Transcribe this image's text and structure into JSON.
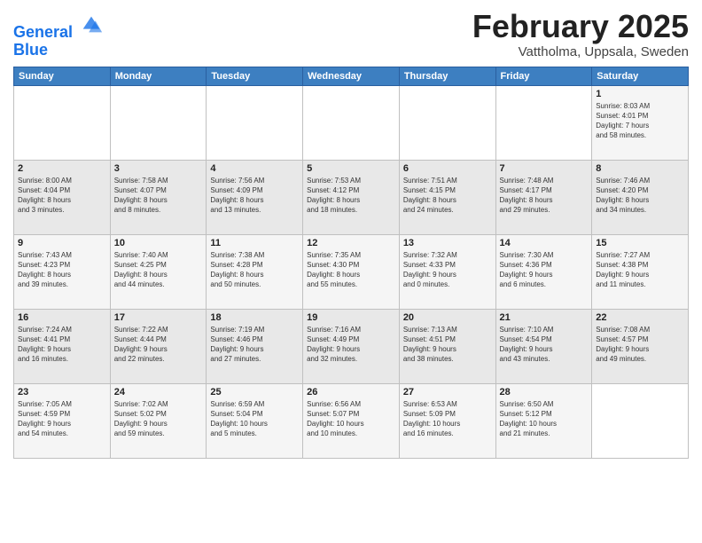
{
  "header": {
    "logo_line1": "General",
    "logo_line2": "Blue",
    "month_title": "February 2025",
    "subtitle": "Vattholma, Uppsala, Sweden"
  },
  "weekdays": [
    "Sunday",
    "Monday",
    "Tuesday",
    "Wednesday",
    "Thursday",
    "Friday",
    "Saturday"
  ],
  "rows": [
    [
      {
        "day": "",
        "info": ""
      },
      {
        "day": "",
        "info": ""
      },
      {
        "day": "",
        "info": ""
      },
      {
        "day": "",
        "info": ""
      },
      {
        "day": "",
        "info": ""
      },
      {
        "day": "",
        "info": ""
      },
      {
        "day": "1",
        "info": "Sunrise: 8:03 AM\nSunset: 4:01 PM\nDaylight: 7 hours\nand 58 minutes."
      }
    ],
    [
      {
        "day": "2",
        "info": "Sunrise: 8:00 AM\nSunset: 4:04 PM\nDaylight: 8 hours\nand 3 minutes."
      },
      {
        "day": "3",
        "info": "Sunrise: 7:58 AM\nSunset: 4:07 PM\nDaylight: 8 hours\nand 8 minutes."
      },
      {
        "day": "4",
        "info": "Sunrise: 7:56 AM\nSunset: 4:09 PM\nDaylight: 8 hours\nand 13 minutes."
      },
      {
        "day": "5",
        "info": "Sunrise: 7:53 AM\nSunset: 4:12 PM\nDaylight: 8 hours\nand 18 minutes."
      },
      {
        "day": "6",
        "info": "Sunrise: 7:51 AM\nSunset: 4:15 PM\nDaylight: 8 hours\nand 24 minutes."
      },
      {
        "day": "7",
        "info": "Sunrise: 7:48 AM\nSunset: 4:17 PM\nDaylight: 8 hours\nand 29 minutes."
      },
      {
        "day": "8",
        "info": "Sunrise: 7:46 AM\nSunset: 4:20 PM\nDaylight: 8 hours\nand 34 minutes."
      }
    ],
    [
      {
        "day": "9",
        "info": "Sunrise: 7:43 AM\nSunset: 4:23 PM\nDaylight: 8 hours\nand 39 minutes."
      },
      {
        "day": "10",
        "info": "Sunrise: 7:40 AM\nSunset: 4:25 PM\nDaylight: 8 hours\nand 44 minutes."
      },
      {
        "day": "11",
        "info": "Sunrise: 7:38 AM\nSunset: 4:28 PM\nDaylight: 8 hours\nand 50 minutes."
      },
      {
        "day": "12",
        "info": "Sunrise: 7:35 AM\nSunset: 4:30 PM\nDaylight: 8 hours\nand 55 minutes."
      },
      {
        "day": "13",
        "info": "Sunrise: 7:32 AM\nSunset: 4:33 PM\nDaylight: 9 hours\nand 0 minutes."
      },
      {
        "day": "14",
        "info": "Sunrise: 7:30 AM\nSunset: 4:36 PM\nDaylight: 9 hours\nand 6 minutes."
      },
      {
        "day": "15",
        "info": "Sunrise: 7:27 AM\nSunset: 4:38 PM\nDaylight: 9 hours\nand 11 minutes."
      }
    ],
    [
      {
        "day": "16",
        "info": "Sunrise: 7:24 AM\nSunset: 4:41 PM\nDaylight: 9 hours\nand 16 minutes."
      },
      {
        "day": "17",
        "info": "Sunrise: 7:22 AM\nSunset: 4:44 PM\nDaylight: 9 hours\nand 22 minutes."
      },
      {
        "day": "18",
        "info": "Sunrise: 7:19 AM\nSunset: 4:46 PM\nDaylight: 9 hours\nand 27 minutes."
      },
      {
        "day": "19",
        "info": "Sunrise: 7:16 AM\nSunset: 4:49 PM\nDaylight: 9 hours\nand 32 minutes."
      },
      {
        "day": "20",
        "info": "Sunrise: 7:13 AM\nSunset: 4:51 PM\nDaylight: 9 hours\nand 38 minutes."
      },
      {
        "day": "21",
        "info": "Sunrise: 7:10 AM\nSunset: 4:54 PM\nDaylight: 9 hours\nand 43 minutes."
      },
      {
        "day": "22",
        "info": "Sunrise: 7:08 AM\nSunset: 4:57 PM\nDaylight: 9 hours\nand 49 minutes."
      }
    ],
    [
      {
        "day": "23",
        "info": "Sunrise: 7:05 AM\nSunset: 4:59 PM\nDaylight: 9 hours\nand 54 minutes."
      },
      {
        "day": "24",
        "info": "Sunrise: 7:02 AM\nSunset: 5:02 PM\nDaylight: 9 hours\nand 59 minutes."
      },
      {
        "day": "25",
        "info": "Sunrise: 6:59 AM\nSunset: 5:04 PM\nDaylight: 10 hours\nand 5 minutes."
      },
      {
        "day": "26",
        "info": "Sunrise: 6:56 AM\nSunset: 5:07 PM\nDaylight: 10 hours\nand 10 minutes."
      },
      {
        "day": "27",
        "info": "Sunrise: 6:53 AM\nSunset: 5:09 PM\nDaylight: 10 hours\nand 16 minutes."
      },
      {
        "day": "28",
        "info": "Sunrise: 6:50 AM\nSunset: 5:12 PM\nDaylight: 10 hours\nand 21 minutes."
      },
      {
        "day": "",
        "info": ""
      }
    ]
  ]
}
